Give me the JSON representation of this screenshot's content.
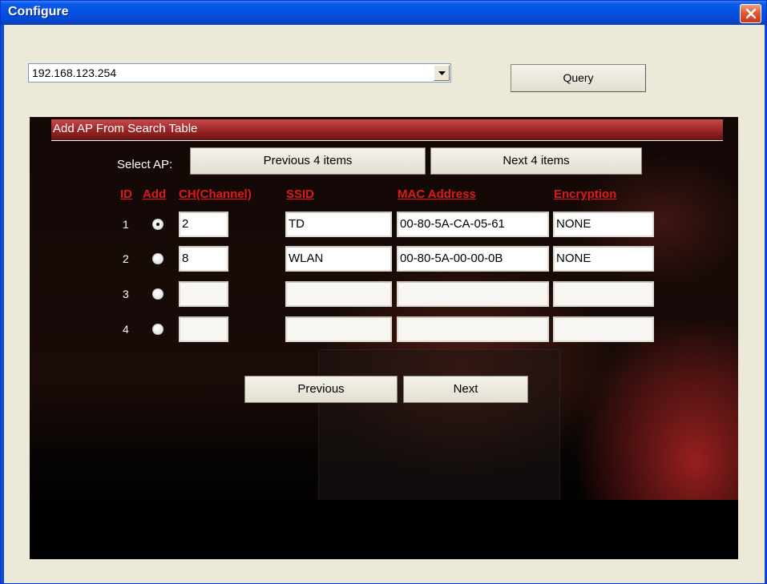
{
  "window": {
    "title": "Configure"
  },
  "ip_select": {
    "value": "192.168.123.254"
  },
  "query_button": {
    "label": "Query"
  },
  "section": {
    "title": "Add AP From Search Table"
  },
  "select_ap": {
    "label": "Select AP:",
    "prev_label": "Previous 4 items",
    "next_label": "Next 4 items"
  },
  "columns": [
    "ID",
    "Add",
    "CH(Channel)",
    "SSID",
    "MAC Address",
    "Encryption"
  ],
  "rows": [
    {
      "id": "1",
      "selected": true,
      "channel": "2",
      "ssid": "TD",
      "mac": "00-80-5A-CA-05-61",
      "encryption": "NONE"
    },
    {
      "id": "2",
      "selected": false,
      "channel": "8",
      "ssid": "WLAN",
      "mac": "00-80-5A-00-00-0B",
      "encryption": "NONE"
    },
    {
      "id": "3",
      "selected": false,
      "channel": "",
      "ssid": "",
      "mac": "",
      "encryption": ""
    },
    {
      "id": "4",
      "selected": false,
      "channel": "",
      "ssid": "",
      "mac": "",
      "encryption": ""
    }
  ],
  "nav": {
    "previous_label": "Previous",
    "next_label": "Next"
  }
}
